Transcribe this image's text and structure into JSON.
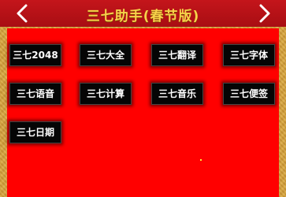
{
  "header": {
    "title": "三七助手(春节版)",
    "back_icon": "chevron-left-icon",
    "forward_icon": "chevron-right-icon"
  },
  "tiles": [
    {
      "label": "三七2048"
    },
    {
      "label": "三七大全"
    },
    {
      "label": "三七翻译"
    },
    {
      "label": "三七字体"
    },
    {
      "label": "三七语音"
    },
    {
      "label": "三七计算"
    },
    {
      "label": "三七音乐"
    },
    {
      "label": "三七便签"
    },
    {
      "label": "三七日期"
    }
  ],
  "colors": {
    "panel": "#ff0000",
    "frame": "#d6a23b",
    "title": "#f7d24a",
    "tile": "#050505"
  }
}
